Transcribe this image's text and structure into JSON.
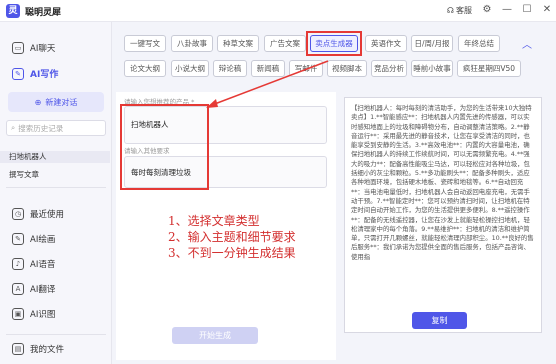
{
  "app": {
    "title": "聪明灵犀",
    "logo_glyph": "灵"
  },
  "titlebar": {
    "vip_label": "客服",
    "settings_label": "⚙",
    "min": "—",
    "max": "☐",
    "close": "✕"
  },
  "sidebar": {
    "chat_label": "AI聊天",
    "write_label": "AI写作",
    "new_chat_label": "新建对话",
    "search_placeholder": "搜索历史记录",
    "history": [
      "扫地机器人",
      "撰写文章"
    ],
    "tools": [
      {
        "label": "最近使用",
        "icon": "clock-icon",
        "glyph": "◷"
      },
      {
        "label": "AI绘画",
        "icon": "paint-icon",
        "glyph": "✎"
      },
      {
        "label": "AI语音",
        "icon": "voice-icon",
        "glyph": "♪"
      },
      {
        "label": "AI翻译",
        "icon": "translate-icon",
        "glyph": "A"
      },
      {
        "label": "AI识图",
        "icon": "image-icon",
        "glyph": "▣"
      }
    ],
    "files_label": "我的文件"
  },
  "tags": {
    "row1": [
      "一键写文",
      "八卦故事",
      "种草文案",
      "广告文案",
      "卖点生成器",
      "英语作文",
      "日/周/月报",
      "年终总结"
    ],
    "row2": [
      "论文大纲",
      "小说大纲",
      "辩论稿",
      "新闻稿",
      "写邮件",
      "视频脚本",
      "竞品分析",
      "睡前小故事",
      "疯狂星期四V50"
    ],
    "active": "卖点生成器"
  },
  "form": {
    "product_label": "请输入您想推荐的产品 *",
    "product_value": "扫地机器人",
    "other_label": "请输入其他要求",
    "other_value": "每时每刻清理垃圾",
    "generate_label": "开始生成"
  },
  "instructions": [
    "1、选择文章类型",
    "2、输入主题和细节要求",
    "3、不到一分钟生成结果"
  ],
  "output": {
    "paragraphs": [
      "【扫地机器人：每时每刻的清洁助手，为您的生活带来10大独特卖点】1.**智能感应**：扫地机器人内置先进的传感器，可以实时感知地面上的垃圾和障碍物分布，自动调整清洁策略。2.**静音运行**：采用最先进的静音技术，让您在享受清洁的同时，也能享受到安静的生活。3.**高效电池**：内置的大容量电池，确保扫地机器人的持续工作续航时间，可以无需频繁充电。4.**强大的吸力**：配备高性能吸尘马达，可以轻松应对各种垃圾，包括细小的灰尘和颗粒。5.**多功能刷头**：配备多种刷头，适应各种地面环境，包括硬木地板、瓷砖和地毯等。6.**自动回充**：当电池电量低时，扫地机器人会自动返回电座充电，无需手动干预。7.**智能定时**：您可以预约清扫时间，让扫地机在特定时间自动开始工作，为您的生活提供更多便利。8.**遥控操作**：配备的无线遥控器，让您在沙发上就能轻松操控扫地机，轻松清理家中的每个角落。9.**易维护**：扫地机的清洁和维护简单，只需打开几颗螺丝，就能轻松清理内部积尘。10.**良好的售后服务**：我们承诺为您提供全面的售后服务，包括产品咨询、使用指"
    ],
    "copy_label": "复制"
  }
}
